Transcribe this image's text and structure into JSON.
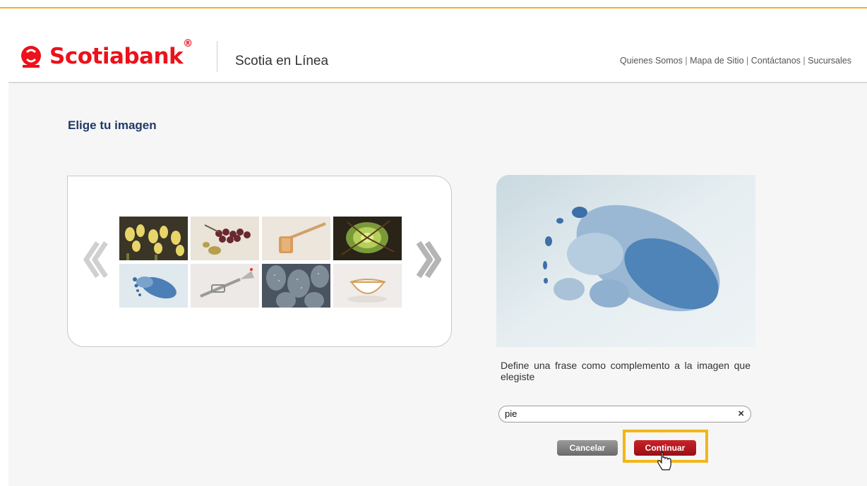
{
  "header": {
    "brand": "Scotiabank",
    "brand_mark": "®",
    "app_title": "Scotia en Línea",
    "links": [
      "Quienes Somos",
      "Mapa de Sitio",
      "Contáctanos",
      "Sucursales"
    ],
    "link_separator": "|"
  },
  "page": {
    "heading": "Elige tu imagen"
  },
  "gallery": {
    "items": [
      "flowers",
      "grapes",
      "wooden-mallet",
      "succulent",
      "footprint",
      "trumpet",
      "cactus",
      "teacup"
    ],
    "selected": "footprint"
  },
  "form": {
    "phrase_label": "Define una frase como complemento a la imagen que elegiste",
    "phrase_value": "pie",
    "clear_symbol": "×",
    "cancel_label": "Cancelar",
    "continue_label": "Continuar"
  },
  "colors": {
    "brand_red": "#ec111a",
    "heading_blue": "#1f3a66",
    "highlight_yellow": "#f2b616"
  }
}
